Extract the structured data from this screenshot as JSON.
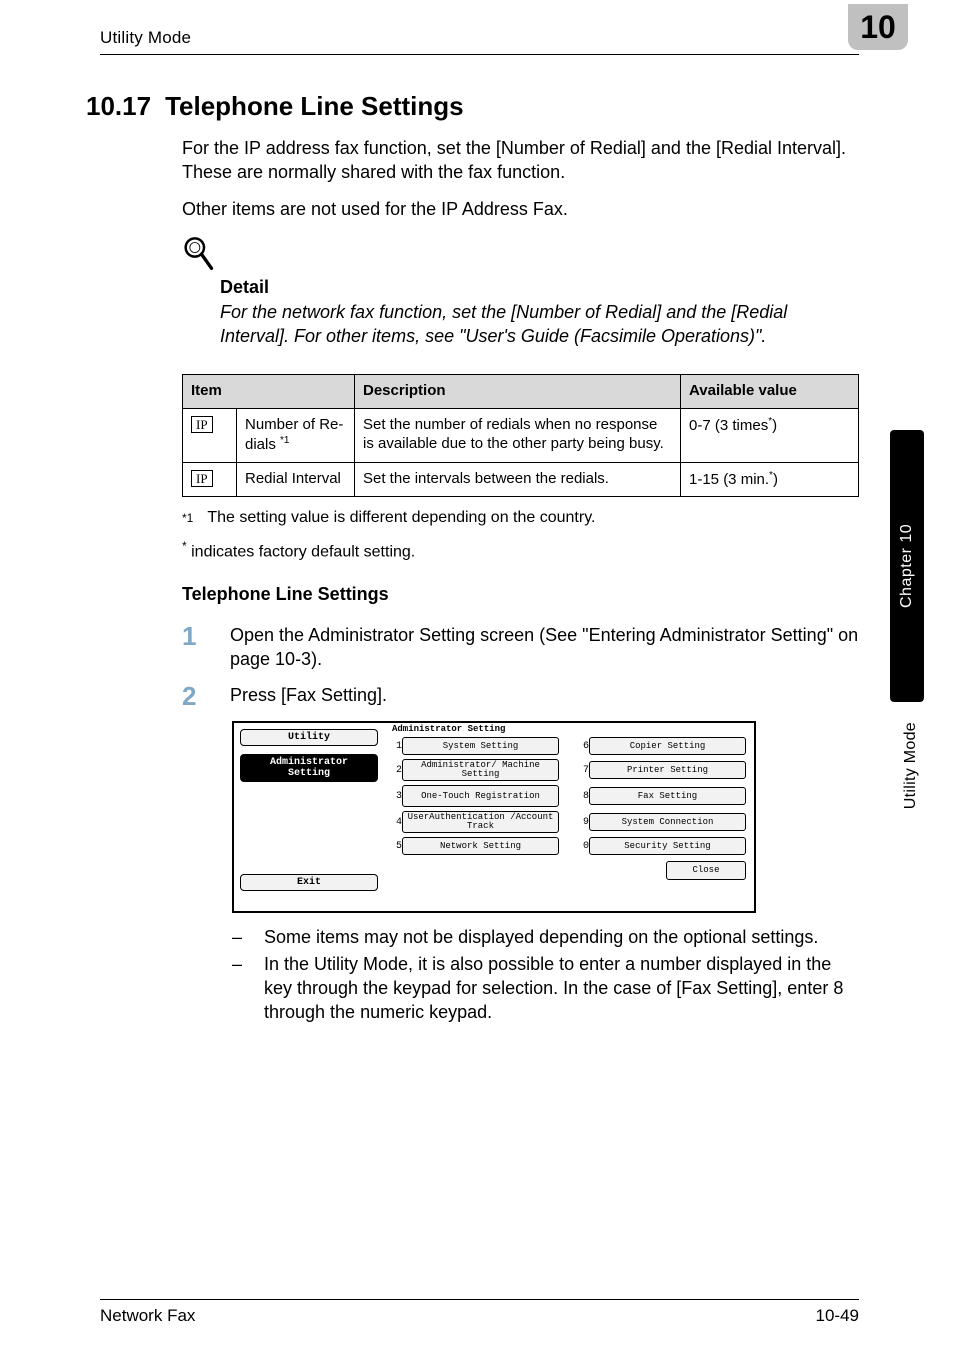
{
  "header": {
    "left": "Utility Mode",
    "page_tab": "10"
  },
  "section": {
    "number": "10.17",
    "title": "Telephone Line Settings"
  },
  "intro": {
    "p1": "For the IP address fax function, set the [Number of Redial] and the [Redial Interval]. These are normally shared with the fax function.",
    "p2": "Other items are not used for the IP Address Fax."
  },
  "detail": {
    "title": "Detail",
    "text": "For the network fax function, set the [Number of Redial] and the [Redial Interval]. For other items, see \"User's Guide (Facsimile Operations)\"."
  },
  "table": {
    "headers": {
      "c1": "Item",
      "c2": "Description",
      "c3": "Available value"
    },
    "rows": [
      {
        "badge": "IP",
        "item_name": "Number of Re-dials ",
        "item_sup": "*1",
        "desc": "Set the number of redials when no response is available due to the other party being busy.",
        "value_pre": "0-7 (3 times",
        "value_sup": "*",
        "value_post": ")"
      },
      {
        "badge": "IP",
        "item_name": "Redial Interval",
        "item_sup": "",
        "desc": "Set the intervals between the redials.",
        "value_pre": "1-15 (3 min.",
        "value_sup": "*",
        "value_post": ")"
      }
    ]
  },
  "footnote": {
    "mark": "*1",
    "text": "The setting value is different depending on the country."
  },
  "factory": {
    "mark": "*",
    "text": " indicates factory default setting."
  },
  "subhead": "Telephone Line Settings",
  "steps": {
    "s1_num": "1",
    "s1_text": "Open the Administrator Setting screen (See \"Entering Administrator Setting\" on page 10-3).",
    "s2_num": "2",
    "s2_text": "Press [Fax Setting]."
  },
  "panel": {
    "left_title": "Utility",
    "left_selected": "Administrator Setting",
    "exit": "Exit",
    "right_head": "Administrator\nSetting",
    "buttons": [
      {
        "n": "1",
        "label": "System Setting"
      },
      {
        "n": "2",
        "label": "Administrator/\nMachine Setting"
      },
      {
        "n": "3",
        "label": "One-Touch\nRegistration"
      },
      {
        "n": "4",
        "label": "UserAuthentication\n/Account Track"
      },
      {
        "n": "5",
        "label": "Network Setting"
      },
      {
        "n": "6",
        "label": "Copier Setting"
      },
      {
        "n": "7",
        "label": "Printer Setting"
      },
      {
        "n": "8",
        "label": "Fax Setting"
      },
      {
        "n": "9",
        "label": "System Connection"
      },
      {
        "n": "0",
        "label": "Security Setting"
      }
    ],
    "close": "Close"
  },
  "notes": {
    "n1": "Some items may not be displayed depending on the optional settings.",
    "n2": "In the Utility Mode, it is also possible to enter a number displayed in the key through the keypad for selection. In the case of [Fax Setting], enter 8 through the numeric keypad."
  },
  "side": {
    "tab": "Chapter 10",
    "label": "Utility Mode"
  },
  "footer": {
    "left": "Network Fax",
    "right": "10-49"
  }
}
